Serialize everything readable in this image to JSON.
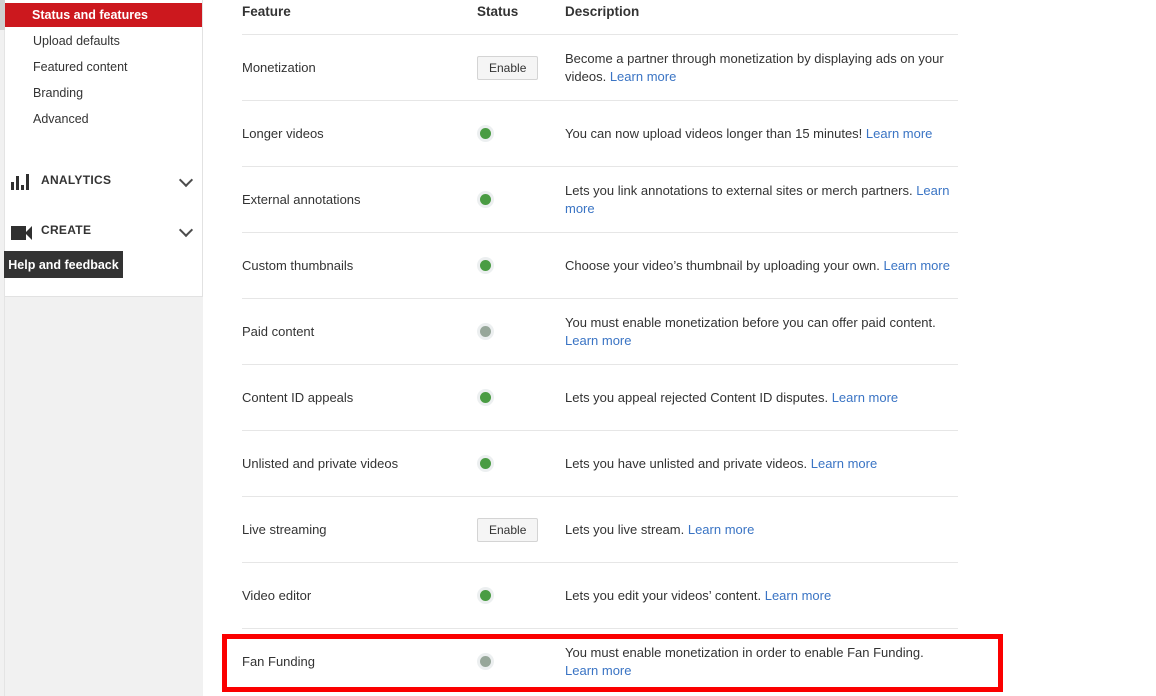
{
  "sidebar": {
    "sub_items": [
      {
        "label": "Status and features",
        "active": true
      },
      {
        "label": "Upload defaults",
        "active": false
      },
      {
        "label": "Featured content",
        "active": false
      },
      {
        "label": "Branding",
        "active": false
      },
      {
        "label": "Advanced",
        "active": false
      }
    ],
    "sections": [
      {
        "label": "ANALYTICS",
        "icon": "bar-chart-icon",
        "chevron": "chevron-down-icon"
      },
      {
        "label": "CREATE",
        "icon": "video-camera-icon",
        "chevron": "chevron-down-icon"
      }
    ],
    "help_button": "Help and feedback"
  },
  "table": {
    "headers": {
      "feature": "Feature",
      "status": "Status",
      "description": "Description"
    },
    "link_label": "Learn more",
    "button_label": "Enable",
    "rows": [
      {
        "feature": "Monetization",
        "status_type": "button",
        "status_value": "Enable",
        "desc_text": "Become a partner through monetization by displaying ads on your videos.",
        "desc_link": "Learn more"
      },
      {
        "feature": "Longer videos",
        "status_type": "dot-on",
        "status_value": "enabled",
        "desc_text": "You can now upload videos longer than 15 minutes!",
        "desc_link": "Learn more"
      },
      {
        "feature": "External annotations",
        "status_type": "dot-on",
        "status_value": "enabled",
        "desc_text": "Lets you link annotations to external sites or merch partners.",
        "desc_link": "Learn more"
      },
      {
        "feature": "Custom thumbnails",
        "status_type": "dot-on",
        "status_value": "enabled",
        "desc_text": "Choose your video’s thumbnail by uploading your own.",
        "desc_link": "Learn more"
      },
      {
        "feature": "Paid content",
        "status_type": "dot-off",
        "status_value": "disabled",
        "desc_text": "You must enable monetization before you can offer paid content.",
        "desc_link": "Learn more"
      },
      {
        "feature": "Content ID appeals",
        "status_type": "dot-on",
        "status_value": "enabled",
        "desc_text": "Lets you appeal rejected Content ID disputes.",
        "desc_link": "Learn more"
      },
      {
        "feature": "Unlisted and private videos",
        "status_type": "dot-on",
        "status_value": "enabled",
        "desc_text": "Lets you have unlisted and private videos.",
        "desc_link": "Learn more"
      },
      {
        "feature": "Live streaming",
        "status_type": "button",
        "status_value": "Enable",
        "desc_text": "Lets you live stream.",
        "desc_link": "Learn more"
      },
      {
        "feature": "Video editor",
        "status_type": "dot-on",
        "status_value": "enabled",
        "desc_text": "Lets you edit your videos’ content.",
        "desc_link": "Learn more"
      },
      {
        "feature": "Fan Funding",
        "status_type": "dot-off",
        "status_value": "disabled",
        "desc_text": "You must enable monetization in order to enable Fan Funding.",
        "desc_link": "Learn more",
        "highlighted": true
      }
    ]
  },
  "colors": {
    "accent_red": "#cc181e",
    "annotation_red": "#fb0000",
    "link_blue": "#3a74c4",
    "status_green": "#4a9c43",
    "status_gray": "#97a79a",
    "help_dark": "#333333"
  }
}
